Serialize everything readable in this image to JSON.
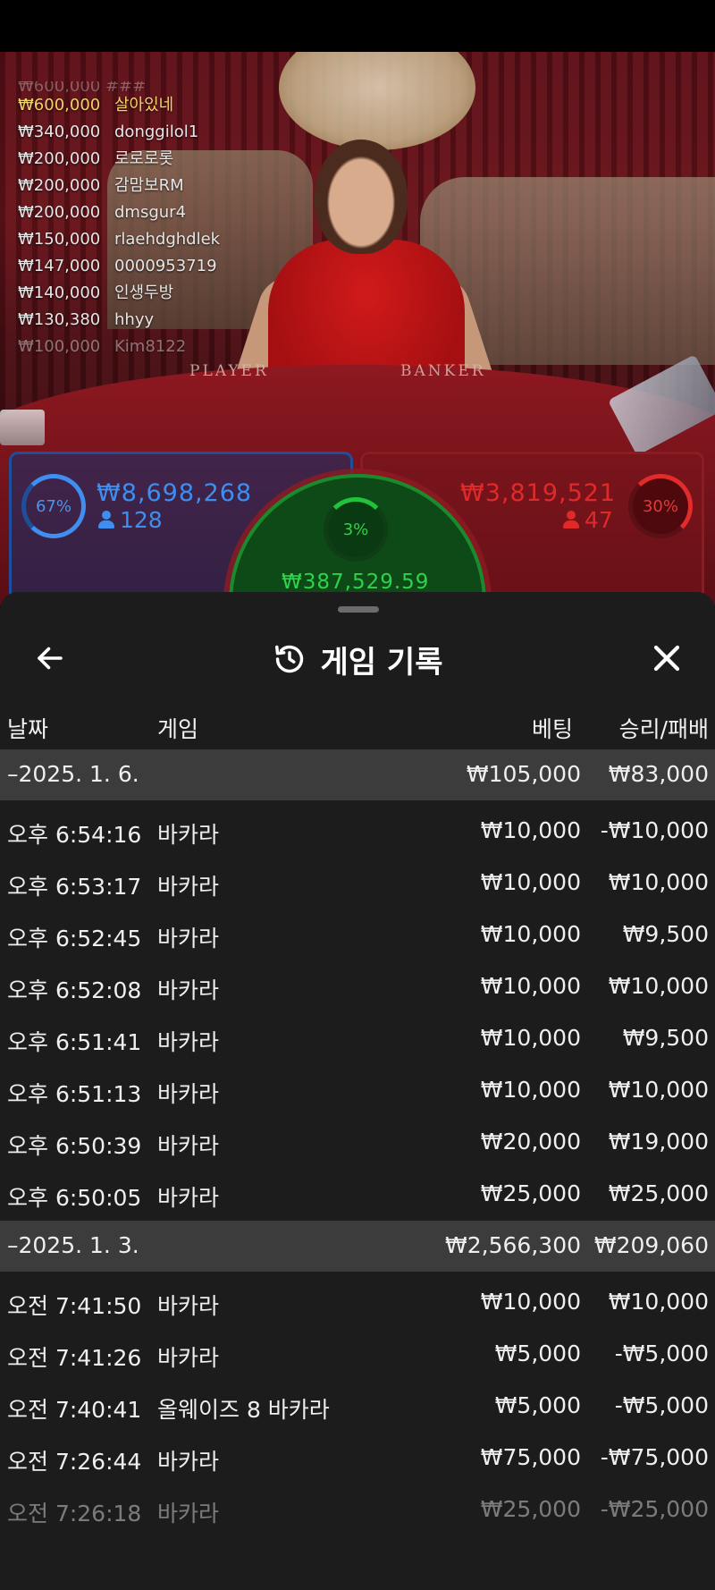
{
  "live": {
    "table_labels": {
      "player": "PLAYER",
      "banker": "BANKER"
    },
    "ticker_partial_top": "₩600,000 ###",
    "ticker": [
      {
        "amount": "₩600,000",
        "user": "살아있네"
      },
      {
        "amount": "₩340,000",
        "user": "donggilol1"
      },
      {
        "amount": "₩200,000",
        "user": "로로로롯"
      },
      {
        "amount": "₩200,000",
        "user": "감맘보RM"
      },
      {
        "amount": "₩200,000",
        "user": "dmsgur4"
      },
      {
        "amount": "₩150,000",
        "user": "rlaehdghdlek"
      },
      {
        "amount": "₩147,000",
        "user": "0000953719"
      },
      {
        "amount": "₩140,000",
        "user": "인생두방"
      },
      {
        "amount": "₩130,380",
        "user": "hhyy"
      },
      {
        "amount": "₩100,000",
        "user": "Kim8122"
      }
    ],
    "player": {
      "percent": "67%",
      "percent_value": 0.67,
      "amount": "₩8,698,268",
      "count": "128",
      "color": "#3e8ef0"
    },
    "banker": {
      "percent": "30%",
      "percent_value": 0.3,
      "amount": "₩3,819,521",
      "count": "47",
      "color": "#e02a2a"
    },
    "tie": {
      "percent": "3%",
      "percent_value": 0.03,
      "amount": "₩387,529.59",
      "color": "#2ed24b"
    }
  },
  "history": {
    "title": "게임 기록",
    "icons": {
      "back": "arrow-left-icon",
      "title": "history-icon",
      "close": "close-icon"
    },
    "columns": {
      "date": "날짜",
      "game": "게임",
      "bet": "베팅",
      "result": "승리/패배"
    },
    "groups": [
      {
        "date": "–2025. 1. 6.",
        "bet_total": "₩105,000",
        "result_total": "₩83,000",
        "rows": [
          {
            "time": "오후 6:54:16",
            "game": "바카라",
            "bet": "₩10,000",
            "result": "-₩10,000"
          },
          {
            "time": "오후 6:53:17",
            "game": "바카라",
            "bet": "₩10,000",
            "result": "₩10,000"
          },
          {
            "time": "오후 6:52:45",
            "game": "바카라",
            "bet": "₩10,000",
            "result": "₩9,500"
          },
          {
            "time": "오후 6:52:08",
            "game": "바카라",
            "bet": "₩10,000",
            "result": "₩10,000"
          },
          {
            "time": "오후 6:51:41",
            "game": "바카라",
            "bet": "₩10,000",
            "result": "₩9,500"
          },
          {
            "time": "오후 6:51:13",
            "game": "바카라",
            "bet": "₩10,000",
            "result": "₩10,000"
          },
          {
            "time": "오후 6:50:39",
            "game": "바카라",
            "bet": "₩20,000",
            "result": "₩19,000"
          },
          {
            "time": "오후 6:50:05",
            "game": "바카라",
            "bet": "₩25,000",
            "result": "₩25,000"
          }
        ]
      },
      {
        "date": "–2025. 1. 3.",
        "bet_total": "₩2,566,300",
        "result_total": "₩209,060",
        "rows": [
          {
            "time": "오전 7:41:50",
            "game": "바카라",
            "bet": "₩10,000",
            "result": "₩10,000"
          },
          {
            "time": "오전 7:41:26",
            "game": "바카라",
            "bet": "₩5,000",
            "result": "-₩5,000"
          },
          {
            "time": "오전 7:40:41",
            "game": "올웨이즈 8 바카라",
            "bet": "₩5,000",
            "result": "-₩5,000"
          },
          {
            "time": "오전 7:26:44",
            "game": "바카라",
            "bet": "₩75,000",
            "result": "-₩75,000"
          },
          {
            "time": "오전 7:26:18",
            "game": "바카라",
            "bet": "₩25,000",
            "result": "-₩25,000"
          }
        ]
      }
    ]
  }
}
